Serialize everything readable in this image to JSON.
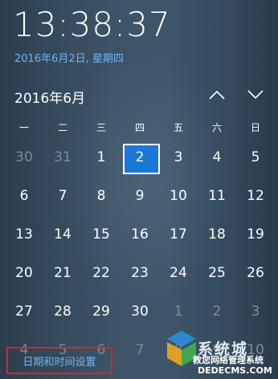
{
  "clock": {
    "time": "13:38:37"
  },
  "date_link": "2016年6月2日, 星期四",
  "calendar": {
    "month_label": "2016年6月",
    "weekdays": [
      "一",
      "二",
      "三",
      "四",
      "五",
      "六",
      "日"
    ],
    "weeks": [
      [
        {
          "d": "30",
          "dim": true
        },
        {
          "d": "31",
          "dim": true
        },
        {
          "d": "1"
        },
        {
          "d": "2",
          "today": true
        },
        {
          "d": "3"
        },
        {
          "d": "4"
        },
        {
          "d": "5"
        }
      ],
      [
        {
          "d": "6"
        },
        {
          "d": "7"
        },
        {
          "d": "8"
        },
        {
          "d": "9"
        },
        {
          "d": "10"
        },
        {
          "d": "11"
        },
        {
          "d": "12"
        }
      ],
      [
        {
          "d": "13"
        },
        {
          "d": "14"
        },
        {
          "d": "15"
        },
        {
          "d": "16"
        },
        {
          "d": "17"
        },
        {
          "d": "18"
        },
        {
          "d": "19"
        }
      ],
      [
        {
          "d": "20"
        },
        {
          "d": "21"
        },
        {
          "d": "22"
        },
        {
          "d": "23"
        },
        {
          "d": "24"
        },
        {
          "d": "25"
        },
        {
          "d": "26"
        }
      ],
      [
        {
          "d": "27"
        },
        {
          "d": "28"
        },
        {
          "d": "29"
        },
        {
          "d": "30"
        },
        {
          "d": "1",
          "dim": true
        },
        {
          "d": "2",
          "dim": true
        },
        {
          "d": "3",
          "dim": true
        }
      ],
      [
        {
          "d": "4",
          "dim": true
        },
        {
          "d": "5",
          "dim": true
        },
        {
          "d": "6",
          "dim": true
        },
        {
          "d": "7",
          "dim": true
        },
        {
          "d": "8",
          "dim": true
        },
        {
          "d": "9",
          "dim": true
        },
        {
          "d": "10",
          "dim": true
        }
      ]
    ]
  },
  "settings_link": "日期和时间设置",
  "watermark": {
    "title": "系统城",
    "subtitle": "教您网络管理系统",
    "url": "DEDECMS.COM"
  },
  "colors": {
    "accent": "#1a78d7",
    "link": "#6fb6f5",
    "highlight_border": "#d82626"
  }
}
